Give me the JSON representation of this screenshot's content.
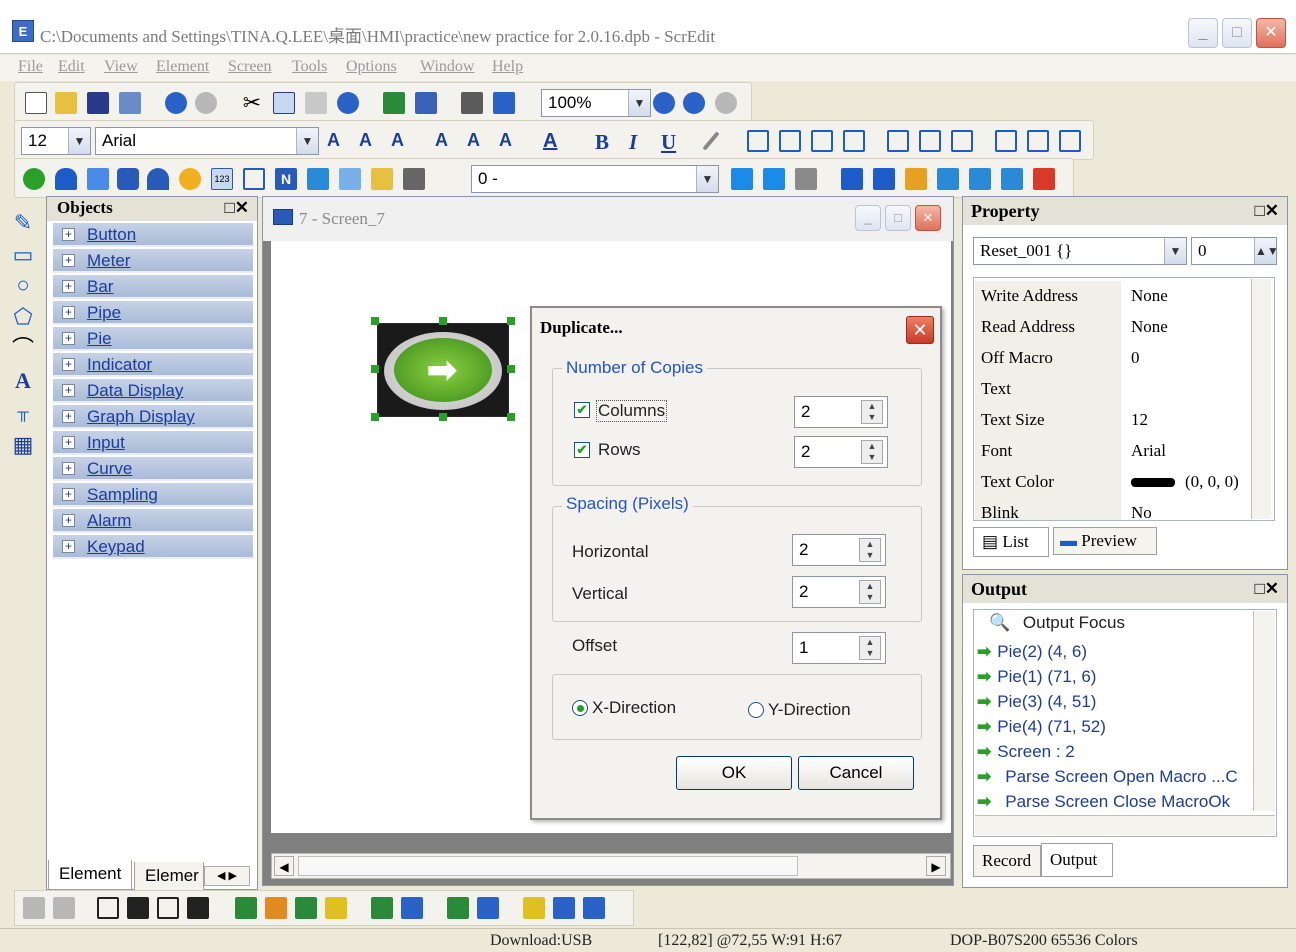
{
  "window": {
    "title": "C:\\Documents and Settings\\TINA.Q.LEE\\桌面\\HMI\\practice\\new practice for 2.0.16.dpb - ScrEdit",
    "app_icon": "E"
  },
  "menu": [
    "File",
    "Edit",
    "View",
    "Element",
    "Screen",
    "Tools",
    "Options",
    "Window",
    "Help"
  ],
  "toolbar": {
    "zoom": "100%",
    "font_size": "12",
    "font_name": "Arial",
    "state_combo": "0 -"
  },
  "objects_panel": {
    "title": "Objects",
    "items": [
      "Button",
      "Meter",
      "Bar",
      "Pipe",
      "Pie",
      "Indicator",
      "Data Display",
      "Graph Display",
      "Input",
      "Curve",
      "Sampling",
      "Alarm",
      "Keypad"
    ],
    "tabs": [
      "Element",
      "Elemer"
    ]
  },
  "screen_window": {
    "title": "7 - Screen_7"
  },
  "dialog": {
    "title": "Duplicate...",
    "copies_group": "Number of Copies",
    "columns_label": "Columns",
    "columns_value": "2",
    "rows_label": "Rows",
    "rows_value": "2",
    "spacing_group": "Spacing (Pixels)",
    "horizontal_label": "Horizontal",
    "horizontal_value": "2",
    "vertical_label": "Vertical",
    "vertical_value": "2",
    "offset_label": "Offset",
    "offset_value": "1",
    "x_direction": "X-Direction",
    "y_direction": "Y-Direction",
    "ok": "OK",
    "cancel": "Cancel"
  },
  "property_panel": {
    "title": "Property",
    "object": "Reset_001 {}",
    "state": "0",
    "rows": [
      {
        "key": "Write Address",
        "value": "None"
      },
      {
        "key": "Read Address",
        "value": "None"
      },
      {
        "key": "Off Macro",
        "value": "0"
      },
      {
        "key": "Text",
        "value": ""
      },
      {
        "key": "Text Size",
        "value": "12"
      },
      {
        "key": "Font",
        "value": "Arial"
      },
      {
        "key": "Text Color",
        "value": "(0, 0, 0)"
      },
      {
        "key": "Blink",
        "value": "No"
      }
    ],
    "tabs": [
      "List",
      "Preview"
    ]
  },
  "output_panel": {
    "title": "Output",
    "header": "Output Focus",
    "rows": [
      "Pie(2) (4, 6)",
      "Pie(1) (71, 6)",
      "Pie(3) (4, 51)",
      "Pie(4) (71, 52)",
      "Screen : 2",
      "Parse Screen Open Macro ...C",
      "Parse Screen Close MacroOk"
    ],
    "tabs": [
      "Record",
      "Output"
    ]
  },
  "status": {
    "download": "Download:USB",
    "coords": "[122,82] @72,55 W:91 H:67",
    "device": "DOP-B07S200 65536 Colors"
  }
}
